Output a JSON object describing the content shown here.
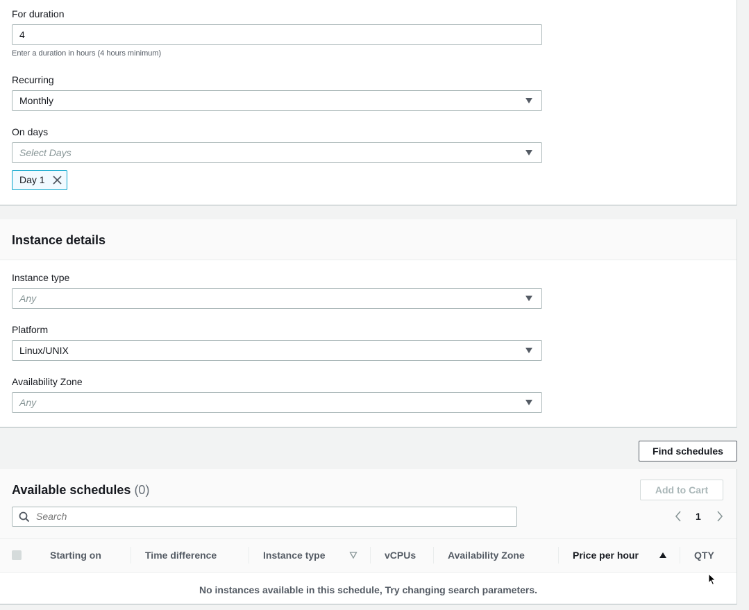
{
  "schedule": {
    "duration_label": "For duration",
    "duration_value": "4",
    "duration_hint": "Enter a duration in hours (4 hours minimum)",
    "recurring_label": "Recurring",
    "recurring_value": "Monthly",
    "on_days_label": "On days",
    "on_days_placeholder": "Select Days",
    "selected_days": [
      "Day 1"
    ]
  },
  "instance_details": {
    "title": "Instance details",
    "instance_type_label": "Instance type",
    "instance_type_placeholder": "Any",
    "platform_label": "Platform",
    "platform_value": "Linux/UNIX",
    "az_label": "Availability Zone",
    "az_placeholder": "Any"
  },
  "actions": {
    "find_schedules": "Find schedules"
  },
  "available": {
    "title": "Available schedules",
    "count": "(0)",
    "add_to_cart": "Add to Cart",
    "search_placeholder": "Search",
    "page": "1",
    "columns": [
      "Starting on",
      "Time difference",
      "Instance type",
      "vCPUs",
      "Availability Zone",
      "Price per hour",
      "QTY"
    ],
    "empty_message": "No instances available in this schedule, Try changing search parameters."
  },
  "colors": {
    "token_border": "#00a1c9",
    "token_bg": "#f1faff",
    "border": "#aab7b8",
    "page_bg": "#f2f3f3"
  },
  "icons": {
    "select_caret": "caret-down-icon",
    "token_remove": "close-icon",
    "search": "search-icon",
    "prev": "chevron-left-icon",
    "next": "chevron-right-icon",
    "sort_filter": "sort-triangle-outline-icon",
    "sort_asc": "sort-triangle-up-icon"
  }
}
